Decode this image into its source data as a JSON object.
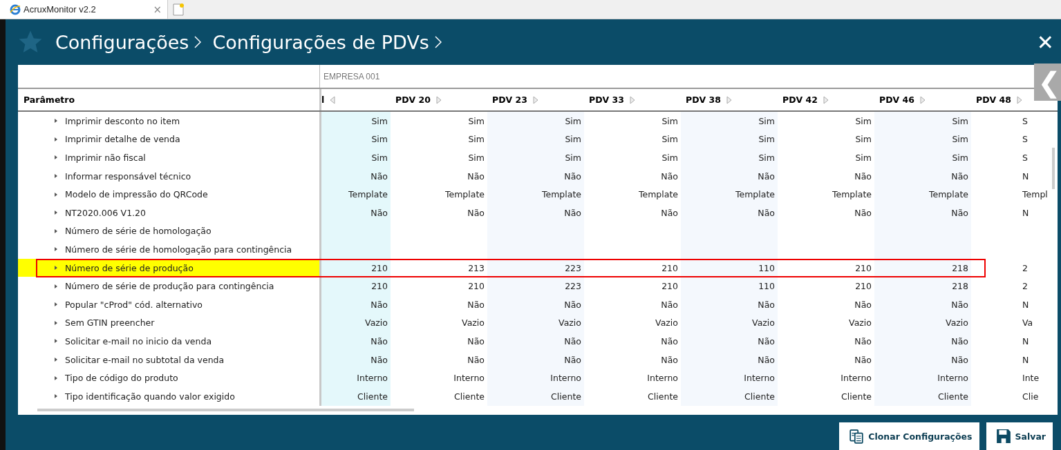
{
  "browser_tab": {
    "title": "AcruxMonitor v2.2",
    "close": "×"
  },
  "breadcrumb": [
    "Configurações",
    "Configurações de PDVs"
  ],
  "close_button": "✕",
  "collapse_button": "❮",
  "table": {
    "group": "EMPRESA 001",
    "param_header": "Parâmetro",
    "columns": [
      "l",
      "PDV 20",
      "PDV 23",
      "PDV 33",
      "PDV 38",
      "PDV 42",
      "PDV 46",
      "PDV 48"
    ],
    "rows": [
      {
        "name": "Imprimir desconto no item",
        "highlighted": false,
        "values": [
          "Sim",
          "Sim",
          "Sim",
          "Sim",
          "Sim",
          "Sim",
          "Sim",
          "S"
        ]
      },
      {
        "name": "Imprimir detalhe de venda",
        "highlighted": false,
        "values": [
          "Sim",
          "Sim",
          "Sim",
          "Sim",
          "Sim",
          "Sim",
          "Sim",
          "S"
        ]
      },
      {
        "name": "Imprimir não fiscal",
        "highlighted": false,
        "values": [
          "Sim",
          "Sim",
          "Sim",
          "Sim",
          "Sim",
          "Sim",
          "Sim",
          "S"
        ]
      },
      {
        "name": "Informar responsável técnico",
        "highlighted": false,
        "values": [
          "Não",
          "Não",
          "Não",
          "Não",
          "Não",
          "Não",
          "Não",
          "N"
        ]
      },
      {
        "name": "Modelo de impressão do QRCode",
        "highlighted": false,
        "values": [
          "Template",
          "Template",
          "Template",
          "Template",
          "Template",
          "Template",
          "Template",
          "Templ"
        ]
      },
      {
        "name": "NT2020.006 V1.20",
        "highlighted": false,
        "values": [
          "Não",
          "Não",
          "Não",
          "Não",
          "Não",
          "Não",
          "Não",
          "N"
        ]
      },
      {
        "name": "Número de série de homologação",
        "highlighted": false,
        "values": []
      },
      {
        "name": "Número de série de homologação para contingência",
        "highlighted": false,
        "values": []
      },
      {
        "name": "Número de série de produção",
        "highlighted": true,
        "values": [
          "210",
          "213",
          "223",
          "210",
          "110",
          "210",
          "218",
          "2"
        ]
      },
      {
        "name": "Número de série de produção para contingência",
        "highlighted": false,
        "values": [
          "210",
          "210",
          "223",
          "210",
          "110",
          "210",
          "218",
          "2"
        ]
      },
      {
        "name": "Popular \"cProd\" cód. alternativo",
        "highlighted": false,
        "values": [
          "Não",
          "Não",
          "Não",
          "Não",
          "Não",
          "Não",
          "Não",
          "N"
        ]
      },
      {
        "name": "Sem GTIN preencher",
        "highlighted": false,
        "values": [
          "Vazio",
          "Vazio",
          "Vazio",
          "Vazio",
          "Vazio",
          "Vazio",
          "Vazio",
          "Va"
        ]
      },
      {
        "name": "Solicitar e-mail no inicio da venda",
        "highlighted": false,
        "values": [
          "Não",
          "Não",
          "Não",
          "Não",
          "Não",
          "Não",
          "Não",
          "N"
        ]
      },
      {
        "name": "Solicitar e-mail no subtotal da venda",
        "highlighted": false,
        "values": [
          "Não",
          "Não",
          "Não",
          "Não",
          "Não",
          "Não",
          "Não",
          "N"
        ]
      },
      {
        "name": "Tipo de código do produto",
        "highlighted": false,
        "values": [
          "Interno",
          "Interno",
          "Interno",
          "Interno",
          "Interno",
          "Interno",
          "Interno",
          "Inte"
        ]
      },
      {
        "name": "Tipo identificação quando valor exigido",
        "highlighted": false,
        "values": [
          "Cliente",
          "Cliente",
          "Cliente",
          "Cliente",
          "Cliente",
          "Cliente",
          "Cliente",
          "Clie"
        ]
      }
    ]
  },
  "buttons": [
    "Clonar Configurações",
    "Salvar"
  ]
}
